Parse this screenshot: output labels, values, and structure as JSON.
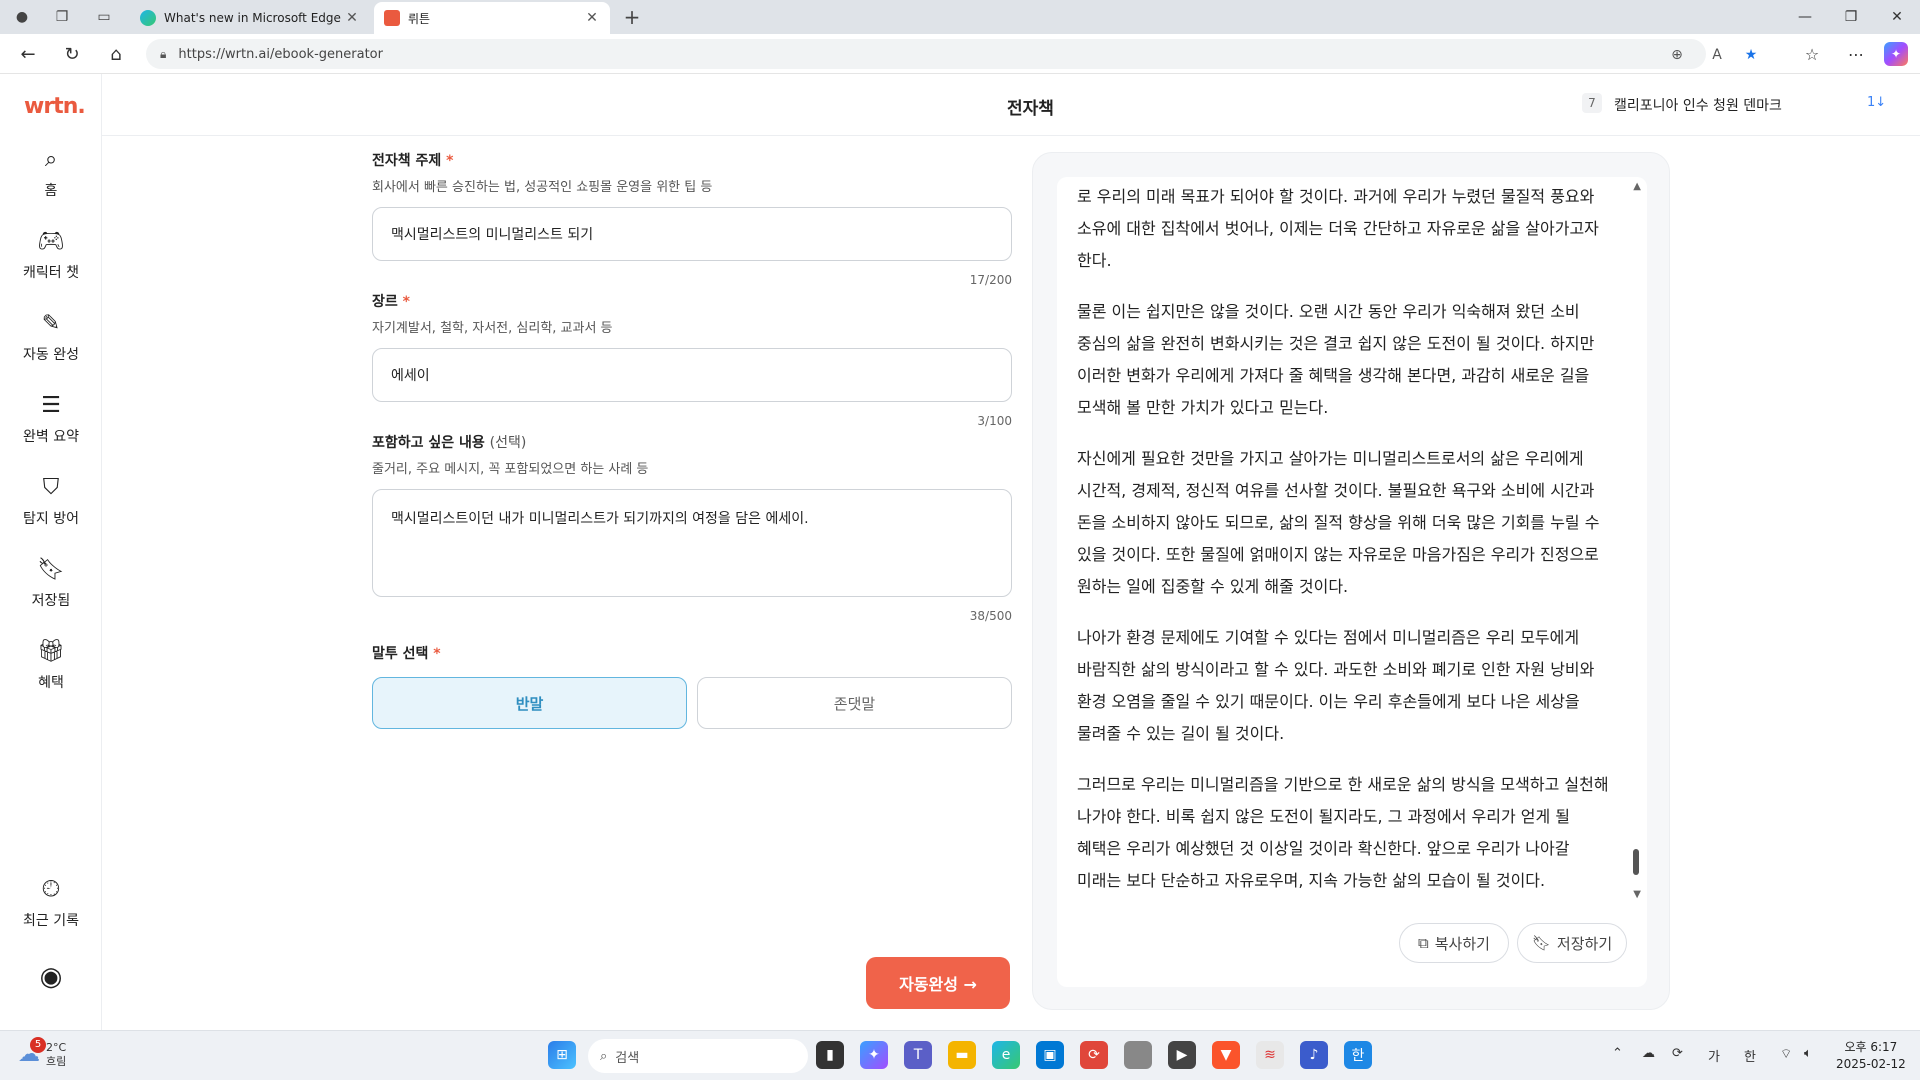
{
  "browser": {
    "tabs": [
      {
        "title": "What's new in Microsoft Edge"
      },
      {
        "title": "뤼튼"
      }
    ],
    "url": "https://wrtn.ai/ebook-generator"
  },
  "sidebar": {
    "logo": "wrtn.",
    "items": [
      {
        "label": "홈",
        "icon": "search-icon"
      },
      {
        "label": "캐릭터 챗",
        "icon": "gamepad-icon"
      },
      {
        "label": "자동 완성",
        "icon": "magic-wand-icon"
      },
      {
        "label": "완벽 요약",
        "icon": "summary-icon"
      },
      {
        "label": "탐지 방어",
        "icon": "shield-gpt-icon"
      },
      {
        "label": "저장됨",
        "icon": "bookmark-icon"
      },
      {
        "label": "혜택",
        "icon": "gift-icon"
      },
      {
        "label": "최근 기록",
        "icon": "clock-icon"
      }
    ],
    "profile_icon": "user-circle-icon"
  },
  "header": {
    "title": "전자책",
    "trending": {
      "rank": "7",
      "text": "캘리포니아 인수 청원 덴마크",
      "change": "1↓"
    }
  },
  "form": {
    "topic": {
      "label": "전자책 주제",
      "required": "*",
      "hint": "회사에서 빠른 승진하는 법, 성공적인 쇼핑몰 운영을 위한 팁 등",
      "value": "맥시멀리스트의 미니멀리스트 되기",
      "counter": "17/200"
    },
    "genre": {
      "label": "장르",
      "required": "*",
      "hint": "자기계발서, 철학, 자서전, 심리학, 교과서 등",
      "value": "에세이",
      "counter": "3/100"
    },
    "content": {
      "label": "포함하고 싶은 내용",
      "optional": "(선택)",
      "hint": "줄거리, 주요 메시지, 꼭 포함되었으면 하는 사례 등",
      "value": "맥시멀리스트이던 내가 미니멀리스트가 되기까지의 여정을 담은 에세이.",
      "counter": "38/500"
    },
    "tone": {
      "label": "말투 선택",
      "required": "*",
      "options": [
        "반말",
        "존댓말"
      ],
      "selected": "반말"
    },
    "submit_label": "자동완성 →"
  },
  "result": {
    "paragraphs": [
      "로 우리의 미래 목표가 되어야 할 것이다. 과거에 우리가 누렸던 물질적 풍요와 소유에 대한 집착에서 벗어나, 이제는 더욱 간단하고 자유로운 삶을 살아가고자 한다.",
      "물론 이는 쉽지만은 않을 것이다. 오랜 시간 동안 우리가 익숙해져 왔던 소비 중심의 삶을 완전히 변화시키는 것은 결코 쉽지 않은 도전이 될 것이다. 하지만 이러한 변화가 우리에게 가져다 줄 혜택을 생각해 본다면, 과감히 새로운 길을 모색해 볼 만한 가치가 있다고 믿는다.",
      "자신에게 필요한 것만을 가지고 살아가는 미니멀리스트로서의 삶은 우리에게 시간적, 경제적, 정신적 여유를 선사할 것이다. 불필요한 욕구와 소비에 시간과 돈을 소비하지 않아도 되므로, 삶의 질적 향상을 위해 더욱 많은 기회를 누릴 수 있을 것이다. 또한 물질에 얽매이지 않는 자유로운 마음가짐은 우리가 진정으로 원하는 일에 집중할 수 있게 해줄 것이다.",
      "나아가 환경 문제에도 기여할 수 있다는 점에서 미니멀리즘은 우리 모두에게 바람직한 삶의 방식이라고 할 수 있다. 과도한 소비와 폐기로 인한 자원 낭비와 환경 오염을 줄일 수 있기 때문이다. 이는 우리 후손들에게 보다 나은 세상을 물려줄 수 있는 길이 될 것이다.",
      "그러므로 우리는 미니멀리즘을 기반으로 한 새로운 삶의 방식을 모색하고 실천해 나가야 한다. 비록 쉽지 않은 도전이 될지라도, 그 과정에서 우리가 얻게 될 혜택은 우리가 예상했던 것 이상일 것이라 확신한다. 앞으로 우리가 나아갈 미래는 보다 단순하고 자유로우며, 지속 가능한 삶의 모습이 될 것이다."
    ],
    "copy_label": "복사하기",
    "save_label": "저장하기"
  },
  "taskbar": {
    "weather": {
      "temp": "2°C",
      "desc": "흐림",
      "badge": "5"
    },
    "search_placeholder": "검색",
    "ime": [
      "가",
      "한"
    ],
    "time": "오후 6:17",
    "date": "2025-02-12"
  },
  "colors": {
    "brand": "#ea5a3f",
    "accent": "#f0634a",
    "selected": "#2f8ec0"
  }
}
